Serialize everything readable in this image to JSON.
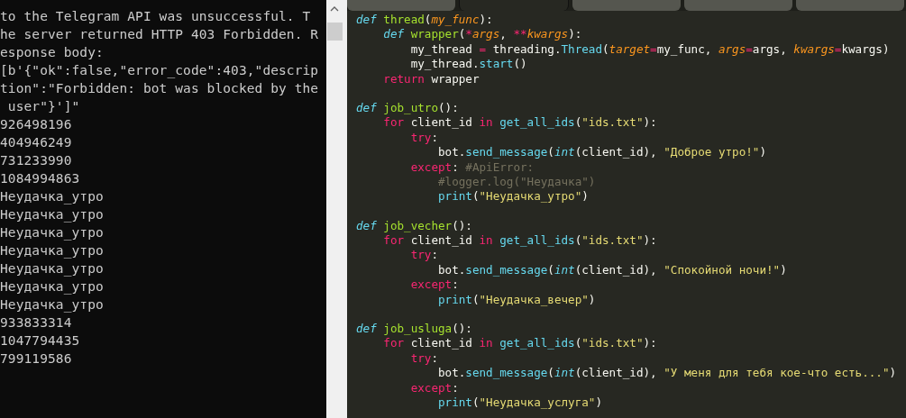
{
  "console": {
    "lines": [
      "to the Telegram API was unsuccessful. T",
      "he server returned HTTP 403 Forbidden. R",
      "esponse body:",
      "[b'{\"ok\":false,\"error_code\":403,\"descrip",
      "tion\":\"Forbidden: bot was blocked by the",
      " user\"}']\"",
      "926498196",
      "404946249",
      "731233990",
      "1084994863",
      "Неудачка_утро",
      "Неудачка_утро",
      "Неудачка_утро",
      "Неудачка_утро",
      "Неудачка_утро",
      "Неудачка_утро",
      "Неудачка_утро",
      "933833314",
      "1047794435",
      "799119586"
    ]
  },
  "editor": {
    "tabs": [
      {
        "selected": false
      },
      {
        "selected": true
      },
      {
        "selected": false
      },
      {
        "selected": false
      },
      {
        "selected": false
      }
    ],
    "blocks": [
      {
        "lines": [
          [
            {
              "kind": "def",
              "text": "def"
            },
            {
              "kind": "function",
              "text": " thread"
            },
            {
              "kind": "plain",
              "text": "("
            },
            {
              "kind": "param",
              "text": "my_func"
            },
            {
              "kind": "plain",
              "text": "):"
            }
          ],
          [
            {
              "kind": "def",
              "text": "    def"
            },
            {
              "kind": "function",
              "text": " wrapper"
            },
            {
              "kind": "plain",
              "text": "("
            },
            {
              "kind": "operator",
              "text": "*"
            },
            {
              "kind": "param",
              "text": "args"
            },
            {
              "kind": "plain",
              "text": ","
            },
            {
              "kind": "operator",
              "text": " **"
            },
            {
              "kind": "param",
              "text": "kwargs"
            },
            {
              "kind": "plain",
              "text": "):"
            }
          ],
          [
            {
              "kind": "plain",
              "text": "        my_thread"
            },
            {
              "kind": "operator",
              "text": " ="
            },
            {
              "kind": "plain",
              "text": " threading."
            },
            {
              "kind": "call",
              "text": "Thread"
            },
            {
              "kind": "plain",
              "text": "("
            },
            {
              "kind": "param",
              "text": "target"
            },
            {
              "kind": "operator",
              "text": "="
            },
            {
              "kind": "plain",
              "text": "my_func,"
            },
            {
              "kind": "param",
              "text": " args"
            },
            {
              "kind": "operator",
              "text": "="
            },
            {
              "kind": "plain",
              "text": "args,"
            },
            {
              "kind": "param",
              "text": " kwargs"
            },
            {
              "kind": "operator",
              "text": "="
            },
            {
              "kind": "plain",
              "text": "kwargs)"
            }
          ],
          [
            {
              "kind": "plain",
              "text": "        my_thread."
            },
            {
              "kind": "call",
              "text": "start"
            },
            {
              "kind": "plain",
              "text": "()"
            }
          ],
          [
            {
              "kind": "keyword",
              "text": "    return"
            },
            {
              "kind": "plain",
              "text": " wrapper"
            }
          ]
        ]
      },
      {
        "lines": [
          [
            {
              "kind": "def",
              "text": "def"
            },
            {
              "kind": "function",
              "text": " job_utro"
            },
            {
              "kind": "plain",
              "text": "():"
            }
          ],
          [
            {
              "kind": "keyword",
              "text": "    for"
            },
            {
              "kind": "plain",
              "text": " client_id"
            },
            {
              "kind": "keyword",
              "text": " in"
            },
            {
              "kind": "call",
              "text": " get_all_ids"
            },
            {
              "kind": "plain",
              "text": "("
            },
            {
              "kind": "string",
              "text": "\"ids.txt\""
            },
            {
              "kind": "plain",
              "text": "):"
            }
          ],
          [
            {
              "kind": "keyword",
              "text": "        try"
            },
            {
              "kind": "plain",
              "text": ":"
            }
          ],
          [
            {
              "kind": "plain",
              "text": "            bot."
            },
            {
              "kind": "call",
              "text": "send_message"
            },
            {
              "kind": "plain",
              "text": "("
            },
            {
              "kind": "type",
              "text": "int"
            },
            {
              "kind": "plain",
              "text": "(client_id),"
            },
            {
              "kind": "string",
              "text": " \"Доброе утро!\""
            },
            {
              "kind": "plain",
              "text": ")"
            }
          ],
          [
            {
              "kind": "keyword",
              "text": "        except"
            },
            {
              "kind": "plain",
              "text": ":"
            },
            {
              "kind": "comment",
              "text": " #ApiError:"
            }
          ],
          [
            {
              "kind": "comment",
              "text": "            #logger.log(\"Неудачка\")"
            }
          ],
          [
            {
              "kind": "call",
              "text": "            print"
            },
            {
              "kind": "plain",
              "text": "("
            },
            {
              "kind": "string",
              "text": "\"Неудачка_утро\""
            },
            {
              "kind": "plain",
              "text": ")"
            }
          ]
        ]
      },
      {
        "lines": [
          [
            {
              "kind": "def",
              "text": "def"
            },
            {
              "kind": "function",
              "text": " job_vecher"
            },
            {
              "kind": "plain",
              "text": "():"
            }
          ],
          [
            {
              "kind": "keyword",
              "text": "    for"
            },
            {
              "kind": "plain",
              "text": " client_id"
            },
            {
              "kind": "keyword",
              "text": " in"
            },
            {
              "kind": "call",
              "text": " get_all_ids"
            },
            {
              "kind": "plain",
              "text": "("
            },
            {
              "kind": "string",
              "text": "\"ids.txt\""
            },
            {
              "kind": "plain",
              "text": "):"
            }
          ],
          [
            {
              "kind": "keyword",
              "text": "        try"
            },
            {
              "kind": "plain",
              "text": ":"
            }
          ],
          [
            {
              "kind": "plain",
              "text": "            bot."
            },
            {
              "kind": "call",
              "text": "send_message"
            },
            {
              "kind": "plain",
              "text": "("
            },
            {
              "kind": "type",
              "text": "int"
            },
            {
              "kind": "plain",
              "text": "(client_id),"
            },
            {
              "kind": "string",
              "text": " \"Спокойной ночи!\""
            },
            {
              "kind": "plain",
              "text": ")"
            }
          ],
          [
            {
              "kind": "keyword",
              "text": "        except"
            },
            {
              "kind": "plain",
              "text": ":"
            }
          ],
          [
            {
              "kind": "call",
              "text": "            print"
            },
            {
              "kind": "plain",
              "text": "("
            },
            {
              "kind": "string",
              "text": "\"Неудачка_вечер\""
            },
            {
              "kind": "plain",
              "text": ")"
            }
          ]
        ]
      },
      {
        "lines": [
          [
            {
              "kind": "def",
              "text": "def"
            },
            {
              "kind": "function",
              "text": " job_usluga"
            },
            {
              "kind": "plain",
              "text": "():"
            }
          ],
          [
            {
              "kind": "keyword",
              "text": "    for"
            },
            {
              "kind": "plain",
              "text": " client_id"
            },
            {
              "kind": "keyword",
              "text": " in"
            },
            {
              "kind": "call",
              "text": " get_all_ids"
            },
            {
              "kind": "plain",
              "text": "("
            },
            {
              "kind": "string",
              "text": "\"ids.txt\""
            },
            {
              "kind": "plain",
              "text": "):"
            }
          ],
          [
            {
              "kind": "keyword",
              "text": "        try"
            },
            {
              "kind": "plain",
              "text": ":"
            }
          ],
          [
            {
              "kind": "plain",
              "text": "            bot."
            },
            {
              "kind": "call",
              "text": "send_message"
            },
            {
              "kind": "plain",
              "text": "("
            },
            {
              "kind": "type",
              "text": "int"
            },
            {
              "kind": "plain",
              "text": "(client_id),"
            },
            {
              "kind": "string",
              "text": " \"У меня для тебя кое-что есть...\""
            },
            {
              "kind": "plain",
              "text": ")"
            }
          ],
          [
            {
              "kind": "keyword",
              "text": "        except"
            },
            {
              "kind": "plain",
              "text": ":"
            }
          ],
          [
            {
              "kind": "call",
              "text": "            print"
            },
            {
              "kind": "plain",
              "text": "("
            },
            {
              "kind": "string",
              "text": "\"Неудачка_услуга\""
            },
            {
              "kind": "plain",
              "text": ")"
            }
          ]
        ]
      }
    ]
  }
}
